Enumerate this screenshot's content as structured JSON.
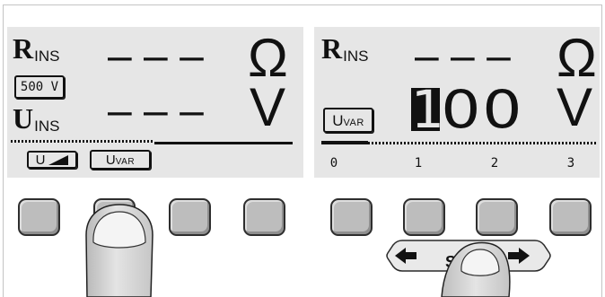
{
  "colors": {
    "display_bg": "#e6e6e6",
    "ink": "#111111",
    "button_fill": "#bdbdbd",
    "button_outline": "#2e2e2e",
    "finger_fill": "#d9d9d9",
    "frame": "#c4c4c4"
  },
  "left_display": {
    "resistance": {
      "symbol": "R",
      "subscript": "INS",
      "reading": "– – –",
      "unit": "Ω"
    },
    "test_voltage": "500 V",
    "voltage": {
      "symbol": "U",
      "subscript": "INS",
      "reading": "– – –",
      "unit": "V"
    },
    "softkey_labels": [
      {
        "symbol": "U",
        "icon": "ramp-icon"
      },
      {
        "symbol": "U",
        "subscript": "VAR"
      }
    ]
  },
  "right_display": {
    "resistance": {
      "symbol": "R",
      "subscript": "INS",
      "reading": "– – –",
      "unit": "Ω"
    },
    "mode": {
      "symbol": "U",
      "subscript": "VAR"
    },
    "voltage_setting": {
      "digits": [
        "1",
        "0",
        "0"
      ],
      "cursor_position": 0,
      "unit": "V"
    },
    "scale_labels": [
      "0",
      "1",
      "2",
      "3"
    ]
  },
  "select_key": {
    "label": "S",
    "left_icon": "arrow-left-icon",
    "right_icon": "arrow-right-icon"
  }
}
